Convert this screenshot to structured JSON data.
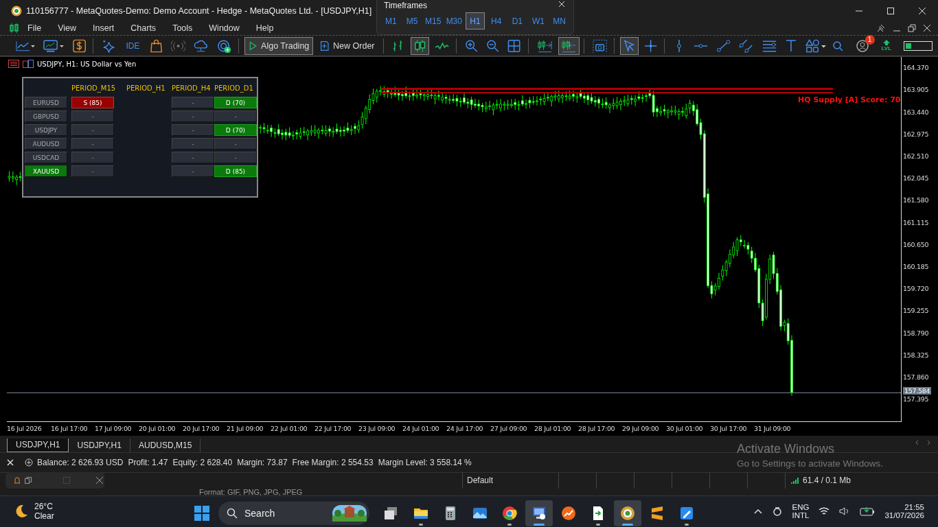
{
  "window": {
    "title": "110156777 - MetaQuotes-Demo: Demo Account - Hedge - MetaQuotes Ltd. - [USDJPY,H1]"
  },
  "timeframes": {
    "title": "Timeframes",
    "items": [
      {
        "label": "M1",
        "selected": false
      },
      {
        "label": "M5",
        "selected": false
      },
      {
        "label": "M15",
        "selected": false
      },
      {
        "label": "M30",
        "selected": false
      },
      {
        "label": "H1",
        "selected": true
      },
      {
        "label": "H4",
        "selected": false
      },
      {
        "label": "D1",
        "selected": false
      },
      {
        "label": "W1",
        "selected": false
      },
      {
        "label": "MN",
        "selected": false
      }
    ]
  },
  "menu": [
    "File",
    "View",
    "Insert",
    "Charts",
    "Tools",
    "Window",
    "Help"
  ],
  "toolbar": {
    "groups": [
      [
        {
          "kind": "linechart",
          "pressed": false
        },
        {
          "kind": "indicators",
          "pressed": false
        },
        {
          "kind": "dollar",
          "pressed": false
        }
      ],
      [
        {
          "kind": "sparkle",
          "pressed": false
        },
        {
          "kind": "ide",
          "label": "IDE",
          "pressed": false
        },
        {
          "kind": "bag",
          "pressed": false
        },
        {
          "kind": "signal",
          "pressed": false
        },
        {
          "kind": "cloud",
          "pressed": false
        },
        {
          "kind": "signals",
          "pressed": false
        }
      ],
      [
        {
          "kind": "algo",
          "label": "Algo Trading",
          "pressed": true
        },
        {
          "kind": "neworder",
          "label": "New Order",
          "pressed": false
        }
      ],
      [
        {
          "kind": "barchart",
          "pressed": false
        },
        {
          "kind": "candles",
          "pressed": true
        },
        {
          "kind": "line",
          "pressed": false
        }
      ],
      [
        {
          "kind": "zoomin",
          "pressed": false
        },
        {
          "kind": "zoomout",
          "pressed": false
        },
        {
          "kind": "grid",
          "pressed": false
        }
      ],
      [
        {
          "kind": "autoscroll",
          "pressed": false
        },
        {
          "kind": "shift",
          "pressed": true
        }
      ],
      [
        {
          "kind": "camera",
          "pressed": false
        }
      ],
      [
        {
          "kind": "cursor",
          "pressed": true
        },
        {
          "kind": "crosshair",
          "pressed": false
        }
      ],
      [
        {
          "kind": "vline",
          "pressed": false
        },
        {
          "kind": "hline",
          "pressed": false
        },
        {
          "kind": "trend",
          "pressed": false
        },
        {
          "kind": "channel",
          "pressed": false
        },
        {
          "kind": "fibo",
          "pressed": false
        },
        {
          "kind": "text",
          "pressed": false
        },
        {
          "kind": "shapes",
          "pressed": false
        }
      ]
    ],
    "notifications": "1",
    "level_label": "LVL"
  },
  "chart": {
    "header": "USDJPY, H1:  US Dollar vs Yen",
    "zone_label": "HQ Supply [A] Score: 70",
    "current_price": "157.584",
    "price_labels": [
      "164.370",
      "163.905",
      "163.440",
      "162.975",
      "162.510",
      "162.045",
      "161.580",
      "161.115",
      "160.650",
      "160.185",
      "159.720",
      "159.255",
      "158.790",
      "158.325",
      "157.860",
      "157.395"
    ],
    "time_labels": [
      "16 Jul 2026",
      "16 Jul 17:00",
      "17 Jul 09:00",
      "20 Jul 01:00",
      "20 Jul 17:00",
      "21 Jul 09:00",
      "22 Jul 01:00",
      "22 Jul 17:00",
      "23 Jul 09:00",
      "24 Jul 01:00",
      "24 Jul 17:00",
      "27 Jul 09:00",
      "28 Jul 01:00",
      "28 Jul 17:00",
      "29 Jul 09:00",
      "30 Jul 01:00",
      "30 Jul 17:00",
      "31 Jul 09:00"
    ]
  },
  "dashboard": {
    "symbols": [
      {
        "label": "EURUSD",
        "selected": false
      },
      {
        "label": "GBPUSD",
        "selected": false
      },
      {
        "label": "USDJPY",
        "selected": false
      },
      {
        "label": "AUDUSD",
        "selected": false
      },
      {
        "label": "USDCAD",
        "selected": false
      },
      {
        "label": "XAUUSD",
        "selected": true
      }
    ],
    "columns": [
      {
        "title": "PERIOD_M15",
        "cells": [
          {
            "text": "S (85)",
            "kind": "sell"
          },
          {
            "text": "-",
            "kind": "empty"
          },
          {
            "text": "-",
            "kind": "empty"
          },
          {
            "text": "-",
            "kind": "empty"
          },
          {
            "text": "-",
            "kind": "empty"
          },
          {
            "text": "-",
            "kind": "empty"
          }
        ]
      },
      {
        "title": "PERIOD_H1"
      },
      {
        "title": "PERIOD_H4",
        "cells": [
          {
            "text": "-",
            "kind": "empty"
          },
          {
            "text": "-",
            "kind": "empty"
          },
          {
            "text": "-",
            "kind": "empty"
          },
          {
            "text": "-",
            "kind": "empty"
          },
          {
            "text": "-",
            "kind": "empty"
          },
          {
            "text": "-",
            "kind": "empty"
          }
        ]
      },
      {
        "title": "PERIOD_D1",
        "cells": [
          {
            "text": "D (70)",
            "kind": "buy"
          },
          {
            "text": "-",
            "kind": "empty"
          },
          {
            "text": "D (70)",
            "kind": "buy"
          },
          {
            "text": "-",
            "kind": "empty"
          },
          {
            "text": "-",
            "kind": "empty"
          },
          {
            "text": "D (85)",
            "kind": "buy"
          }
        ]
      }
    ]
  },
  "chart_tabs": [
    {
      "label": "USDJPY,H1",
      "selected": true
    },
    {
      "label": "USDJPY,H1",
      "selected": false
    },
    {
      "label": "AUDUSD,M15",
      "selected": false
    }
  ],
  "account": [
    "Balance: 2 626.93 USD",
    "Profit: 1.47",
    "Equity: 2 628.40",
    "Margin: 73.87",
    "Free Margin: 2 554.53",
    "Margin Level: 3 558.14 %"
  ],
  "activation": {
    "title": "Activate Windows",
    "message": "Go to Settings to activate Windows."
  },
  "status_bar": {
    "profile": "Default",
    "traffic": "61.4 / 0.1 Mb"
  },
  "background_text": "Format: GIF, PNG, JPG, JPEG",
  "taskbar": {
    "weather": {
      "temperature": "26°C",
      "condition": "Clear"
    },
    "search": {
      "placeholder": "Search"
    },
    "apps": [
      {
        "kind": "taskview",
        "running": false,
        "selected": false
      },
      {
        "kind": "explorer",
        "running": true,
        "selected": false
      },
      {
        "kind": "calculator",
        "running": false,
        "selected": false
      },
      {
        "kind": "photos",
        "running": false,
        "selected": false
      },
      {
        "kind": "chrome",
        "running": true,
        "selected": false
      },
      {
        "kind": "remote",
        "running": true,
        "selected": true
      },
      {
        "kind": "chartapp",
        "running": false,
        "selected": false
      },
      {
        "kind": "document",
        "running": true,
        "selected": false
      },
      {
        "kind": "metatrader",
        "running": true,
        "selected": true
      },
      {
        "kind": "sublime",
        "running": false,
        "selected": false
      },
      {
        "kind": "paint",
        "running": true,
        "selected": false
      }
    ],
    "language": "ENG",
    "layout": "INTL",
    "time": "21:55",
    "date": "31/07/2026"
  }
}
